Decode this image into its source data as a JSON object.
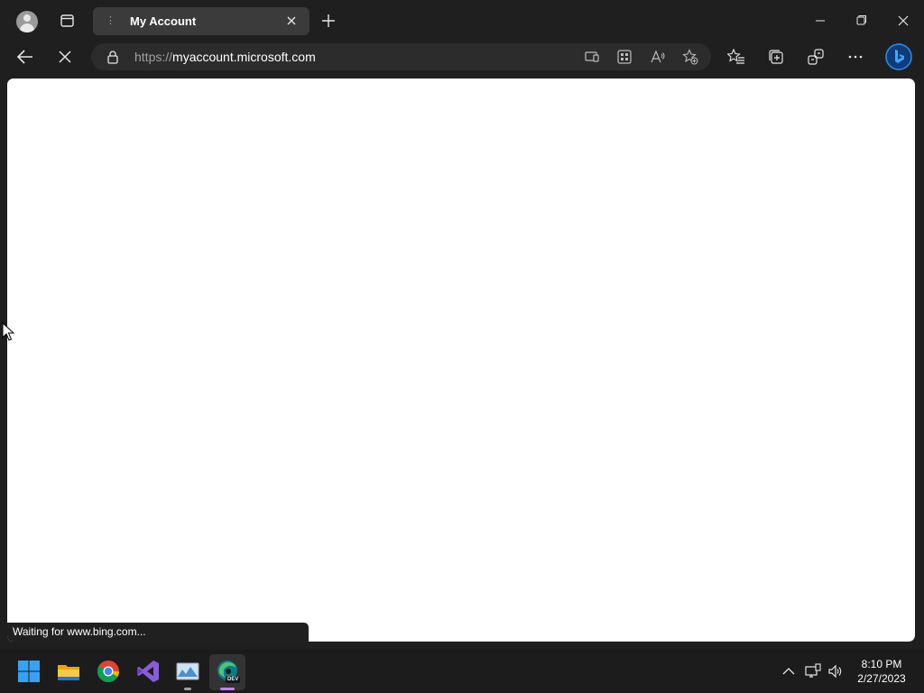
{
  "browser": {
    "tab": {
      "title": "My Account"
    },
    "address": {
      "protocol": "https://",
      "host": "myaccount.microsoft.com"
    },
    "status_text": "Waiting for www.bing.com..."
  },
  "taskbar": {
    "apps": [
      "windows-start",
      "file-explorer",
      "chrome",
      "visual-studio",
      "screenshot-tool",
      "edge-dev"
    ],
    "active_app": "edge-dev",
    "edge_badge": "DEV",
    "clock": {
      "time": "8:10 PM",
      "date": "2/27/2023"
    }
  },
  "colors": {
    "chrome_bg": "#1f1f1f",
    "tab_active": "#3b3b3b",
    "address_bg": "#2c2c2c",
    "accent": "#0078d4"
  }
}
